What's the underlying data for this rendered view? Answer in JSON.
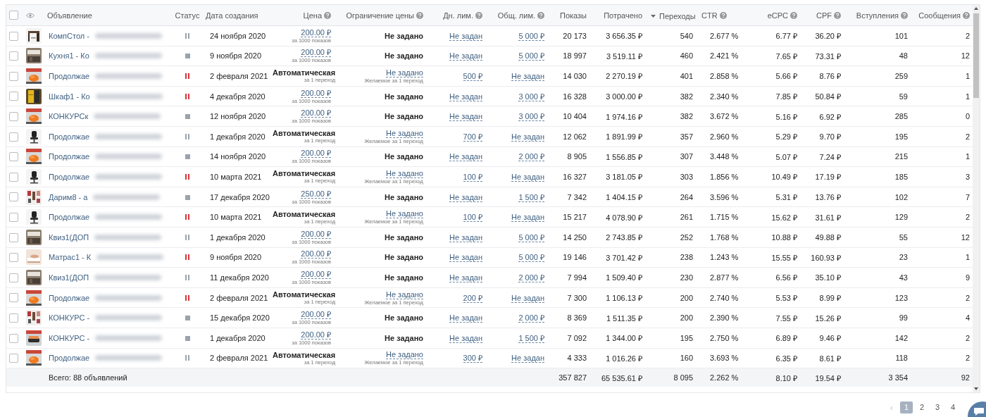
{
  "table": {
    "select_all": {
      "checked": false
    },
    "columns": [
      {
        "label": "Объявление",
        "help": false,
        "sorted": false
      },
      {
        "label": "Статус",
        "help": false,
        "sorted": false
      },
      {
        "label": "Дата создания",
        "help": false,
        "sorted": false
      },
      {
        "label": "Цена",
        "help": true,
        "sorted": false
      },
      {
        "label": "Ограничение цены",
        "help": true,
        "sorted": false
      },
      {
        "label": "Дн. лим.",
        "help": true,
        "sorted": false
      },
      {
        "label": "Общ. лим.",
        "help": true,
        "sorted": false
      },
      {
        "label": "Показы",
        "help": false,
        "sorted": false
      },
      {
        "label": "Потрачено",
        "help": false,
        "sorted": false
      },
      {
        "label": "Переходы",
        "help": false,
        "sorted": true
      },
      {
        "label": "CTR",
        "help": true,
        "sorted": false
      },
      {
        "label": "eCPC",
        "help": true,
        "sorted": false
      },
      {
        "label": "CPF",
        "help": true,
        "sorted": false
      },
      {
        "label": "Вступления",
        "help": true,
        "sorted": false
      },
      {
        "label": "Сообщения",
        "help": true,
        "sorted": false
      }
    ],
    "rows": [
      {
        "checked": false,
        "name": "КомпСтол -",
        "status": {
          "kind": "pause",
          "color": "#9aa3ad"
        },
        "date": "24 ноября 2020",
        "price": {
          "kind": "fixed",
          "value": "200.00 ₽",
          "note": "за 1000 показов"
        },
        "limit": {
          "kind": "plain",
          "value": "Не задано"
        },
        "day_limit": "Не задан",
        "total_limit": "5 000 ₽",
        "shows": "20 173",
        "spent": "3 656.35 ₽",
        "clicks": "540",
        "ctr": "2.677 %",
        "ecpc": "6.77 ₽",
        "cpf": "36.20 ₽",
        "joins": "101",
        "messages": "2"
      },
      {
        "checked": false,
        "name": "Кухня1 - Ко",
        "status": {
          "kind": "stop",
          "color": "#9aa3ad"
        },
        "date": "9 ноября 2020",
        "price": {
          "kind": "fixed",
          "value": "200.00 ₽",
          "note": "за 1000 показов"
        },
        "limit": {
          "kind": "plain",
          "value": "Не задано"
        },
        "day_limit": "Не задан",
        "total_limit": "5 000 ₽",
        "shows": "18 997",
        "spent": "3 519.11 ₽",
        "clicks": "460",
        "ctr": "2.421 %",
        "ecpc": "7.65 ₽",
        "cpf": "73.31 ₽",
        "joins": "48",
        "messages": "12"
      },
      {
        "checked": false,
        "name": "Продолжае",
        "status": {
          "kind": "pause",
          "color": "#d6333b"
        },
        "date": "2 февраля 2021",
        "price": {
          "kind": "auto",
          "value": "Автоматическая",
          "note": "за 1 переход"
        },
        "limit": {
          "kind": "link",
          "value": "Не задано",
          "note": "Желаемое за 1 переход"
        },
        "day_limit": "500 ₽",
        "total_limit": "Не задан",
        "shows": "14 030",
        "spent": "2 270.19 ₽",
        "clicks": "401",
        "ctr": "2.858 %",
        "ecpc": "5.66 ₽",
        "cpf": "8.76 ₽",
        "joins": "259",
        "messages": "1"
      },
      {
        "checked": false,
        "name": "Шкаф1 - Ко",
        "status": {
          "kind": "pause",
          "color": "#d6333b"
        },
        "date": "4 декабря 2020",
        "price": {
          "kind": "fixed",
          "value": "200.00 ₽",
          "note": "за 1000 показов"
        },
        "limit": {
          "kind": "plain",
          "value": "Не задано"
        },
        "day_limit": "Не задан",
        "total_limit": "3 000 ₽",
        "shows": "16 328",
        "spent": "3 000.00 ₽",
        "clicks": "382",
        "ctr": "2.340 %",
        "ecpc": "7.85 ₽",
        "cpf": "50.84 ₽",
        "joins": "59",
        "messages": "1"
      },
      {
        "checked": false,
        "name": "КОНКУРСк",
        "status": {
          "kind": "stop",
          "color": "#9aa3ad"
        },
        "date": "12 ноября 2020",
        "price": {
          "kind": "fixed",
          "value": "200.00 ₽",
          "note": "за 1000 показов"
        },
        "limit": {
          "kind": "plain",
          "value": "Не задано"
        },
        "day_limit": "Не задан",
        "total_limit": "3 000 ₽",
        "shows": "10 404",
        "spent": "1 974.16 ₽",
        "clicks": "382",
        "ctr": "3.672 %",
        "ecpc": "5.16 ₽",
        "cpf": "6.92 ₽",
        "joins": "285",
        "messages": "0"
      },
      {
        "checked": false,
        "name": "Продолжае",
        "status": {
          "kind": "pause",
          "color": "#9aa3ad"
        },
        "date": "1 декабря 2020",
        "price": {
          "kind": "auto",
          "value": "Автоматическая",
          "note": "за 1 переход"
        },
        "limit": {
          "kind": "link",
          "value": "Не задано",
          "note": "Желаемое за 1 переход"
        },
        "day_limit": "700 ₽",
        "total_limit": "Не задан",
        "shows": "12 062",
        "spent": "1 891.99 ₽",
        "clicks": "357",
        "ctr": "2.960 %",
        "ecpc": "5.29 ₽",
        "cpf": "9.70 ₽",
        "joins": "195",
        "messages": "2"
      },
      {
        "checked": false,
        "name": "Продолжае",
        "status": {
          "kind": "stop",
          "color": "#9aa3ad"
        },
        "date": "14 ноября 2020",
        "price": {
          "kind": "fixed",
          "value": "200.00 ₽",
          "note": "за 1000 показов"
        },
        "limit": {
          "kind": "plain",
          "value": "Не задано"
        },
        "day_limit": "Не задан",
        "total_limit": "2 000 ₽",
        "shows": "8 905",
        "spent": "1 556.85 ₽",
        "clicks": "307",
        "ctr": "3.448 %",
        "ecpc": "5.07 ₽",
        "cpf": "7.24 ₽",
        "joins": "215",
        "messages": "1"
      },
      {
        "checked": false,
        "name": "Продолжае",
        "status": {
          "kind": "pause",
          "color": "#d6333b"
        },
        "date": "10 марта 2021",
        "price": {
          "kind": "auto",
          "value": "Автоматическая",
          "note": "за 1 переход"
        },
        "limit": {
          "kind": "link",
          "value": "Не задано",
          "note": "Желаемое за 1 переход"
        },
        "day_limit": "100 ₽",
        "total_limit": "Не задан",
        "shows": "16 327",
        "spent": "3 181.05 ₽",
        "clicks": "303",
        "ctr": "1.856 %",
        "ecpc": "10.49 ₽",
        "cpf": "17.19 ₽",
        "joins": "185",
        "messages": "3"
      },
      {
        "checked": false,
        "name": "Дарим8 - а",
        "status": {
          "kind": "stop",
          "color": "#9aa3ad"
        },
        "date": "17 декабря 2020",
        "price": {
          "kind": "fixed",
          "value": "250.00 ₽",
          "note": "за 1000 показов"
        },
        "limit": {
          "kind": "plain",
          "value": "Не задано"
        },
        "day_limit": "Не задан",
        "total_limit": "1 500 ₽",
        "shows": "7 342",
        "spent": "1 404.15 ₽",
        "clicks": "264",
        "ctr": "3.596 %",
        "ecpc": "5.31 ₽",
        "cpf": "13.76 ₽",
        "joins": "102",
        "messages": "7"
      },
      {
        "checked": false,
        "name": "Продолжае",
        "status": {
          "kind": "pause",
          "color": "#d6333b"
        },
        "date": "10 марта 2021",
        "price": {
          "kind": "auto",
          "value": "Автоматическая",
          "note": "за 1 переход"
        },
        "limit": {
          "kind": "link",
          "value": "Не задано",
          "note": "Желаемое за 1 переход"
        },
        "day_limit": "100 ₽",
        "total_limit": "Не задан",
        "shows": "15 217",
        "spent": "4 078.90 ₽",
        "clicks": "261",
        "ctr": "1.715 %",
        "ecpc": "15.62 ₽",
        "cpf": "31.61 ₽",
        "joins": "129",
        "messages": "2"
      },
      {
        "checked": false,
        "name": "Квиз1(ДОП",
        "status": {
          "kind": "pause",
          "color": "#9aa3ad"
        },
        "date": "1 декабря 2020",
        "price": {
          "kind": "fixed",
          "value": "200.00 ₽",
          "note": "за 1000 показов"
        },
        "limit": {
          "kind": "plain",
          "value": "Не задано"
        },
        "day_limit": "Не задан",
        "total_limit": "5 000 ₽",
        "shows": "14 250",
        "spent": "2 743.85 ₽",
        "clicks": "252",
        "ctr": "1.768 %",
        "ecpc": "10.88 ₽",
        "cpf": "49.88 ₽",
        "joins": "55",
        "messages": "12"
      },
      {
        "checked": false,
        "name": "Матрас1 - К",
        "status": {
          "kind": "pause",
          "color": "#d6333b"
        },
        "date": "9 ноября 2020",
        "price": {
          "kind": "fixed",
          "value": "200.00 ₽",
          "note": "за 1000 показов"
        },
        "limit": {
          "kind": "plain",
          "value": "Не задано"
        },
        "day_limit": "Не задан",
        "total_limit": "5 000 ₽",
        "shows": "19 146",
        "spent": "3 701.42 ₽",
        "clicks": "238",
        "ctr": "1.243 %",
        "ecpc": "15.55 ₽",
        "cpf": "160.93 ₽",
        "joins": "23",
        "messages": "1"
      },
      {
        "checked": false,
        "name": "Квиз1(ДОП",
        "status": {
          "kind": "pause",
          "color": "#9aa3ad"
        },
        "date": "11 декабря 2020",
        "price": {
          "kind": "fixed",
          "value": "200.00 ₽",
          "note": "за 1000 показов"
        },
        "limit": {
          "kind": "plain",
          "value": "Не задано"
        },
        "day_limit": "Не задан",
        "total_limit": "2 000 ₽",
        "shows": "7 994",
        "spent": "1 509.40 ₽",
        "clicks": "230",
        "ctr": "2.877 %",
        "ecpc": "6.56 ₽",
        "cpf": "35.10 ₽",
        "joins": "43",
        "messages": "9"
      },
      {
        "checked": false,
        "name": "Продолжае",
        "status": {
          "kind": "pause",
          "color": "#d6333b"
        },
        "date": "2 февраля 2021",
        "price": {
          "kind": "auto",
          "value": "Автоматическая",
          "note": "за 1 переход"
        },
        "limit": {
          "kind": "link",
          "value": "Не задано",
          "note": "Желаемое за 1 переход"
        },
        "day_limit": "200 ₽",
        "total_limit": "Не задан",
        "shows": "7 300",
        "spent": "1 106.13 ₽",
        "clicks": "200",
        "ctr": "2.740 %",
        "ecpc": "5.53 ₽",
        "cpf": "8.99 ₽",
        "joins": "123",
        "messages": "2"
      },
      {
        "checked": false,
        "name": "КОНКУРС -",
        "status": {
          "kind": "stop",
          "color": "#9aa3ad"
        },
        "date": "15 декабря 2020",
        "price": {
          "kind": "fixed",
          "value": "200.00 ₽",
          "note": "за 1000 показов"
        },
        "limit": {
          "kind": "plain",
          "value": "Не задано"
        },
        "day_limit": "Не задан",
        "total_limit": "2 000 ₽",
        "shows": "8 369",
        "spent": "1 511.35 ₽",
        "clicks": "200",
        "ctr": "2.390 %",
        "ecpc": "7.55 ₽",
        "cpf": "15.26 ₽",
        "joins": "99",
        "messages": "4"
      },
      {
        "checked": false,
        "name": "КОНКУРС -",
        "status": {
          "kind": "stop",
          "color": "#9aa3ad"
        },
        "date": "1 декабря 2020",
        "price": {
          "kind": "fixed",
          "value": "200.00 ₽",
          "note": "за 1000 показов"
        },
        "limit": {
          "kind": "plain",
          "value": "Не задано"
        },
        "day_limit": "Не задан",
        "total_limit": "1 500 ₽",
        "shows": "7 092",
        "spent": "1 344.00 ₽",
        "clicks": "195",
        "ctr": "2.750 %",
        "ecpc": "6.89 ₽",
        "cpf": "9.46 ₽",
        "joins": "142",
        "messages": "2"
      },
      {
        "checked": false,
        "name": "Продолжае",
        "status": {
          "kind": "pause",
          "color": "#9aa3ad"
        },
        "date": "2 февраля 2021",
        "price": {
          "kind": "auto",
          "value": "Автоматическая",
          "note": "за 1 переход"
        },
        "limit": {
          "kind": "link",
          "value": "Не задано",
          "note": "Желаемое за 1 переход"
        },
        "day_limit": "300 ₽",
        "total_limit": "Не задан",
        "shows": "4 333",
        "spent": "1 016.26 ₽",
        "clicks": "160",
        "ctr": "3.693 %",
        "ecpc": "6.35 ₽",
        "cpf": "8.61 ₽",
        "joins": "118",
        "messages": "2"
      }
    ],
    "totals": {
      "label": "Всего: 88 объявлений",
      "shows": "357 827",
      "spent": "65 535.61 ₽",
      "clicks": "8 095",
      "ctr": "2.262 %",
      "ecpc": "8.10 ₽",
      "cpf": "19.54 ₽",
      "joins": "3 354",
      "messages": "92"
    }
  },
  "pagination": {
    "prev": "‹",
    "pages": [
      {
        "label": "1",
        "selected": true
      },
      {
        "label": "2",
        "selected": false
      },
      {
        "label": "3",
        "selected": false
      },
      {
        "label": "4",
        "selected": false
      }
    ]
  }
}
